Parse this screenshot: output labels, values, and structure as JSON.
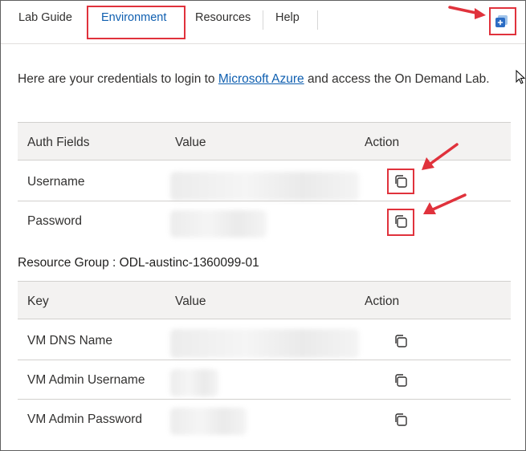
{
  "tabs": [
    {
      "label": "Lab Guide",
      "active": false
    },
    {
      "label": "Environment",
      "active": true
    },
    {
      "label": "Resources",
      "active": false
    },
    {
      "label": "Help",
      "active": false
    }
  ],
  "intro": {
    "before": "Here are your credentials to login to ",
    "link": "Microsoft Azure",
    "after": " and access the On Demand Lab."
  },
  "credentials_table": {
    "headers": [
      "Auth Fields",
      "Value",
      "Action"
    ],
    "rows": [
      {
        "field": "Username"
      },
      {
        "field": "Password"
      }
    ]
  },
  "resource_group": {
    "label": "Resource Group : ODL-austinc-1360099-01"
  },
  "vm_table": {
    "headers": [
      "Key",
      "Value",
      "Action"
    ],
    "rows": [
      {
        "field": "VM DNS Name"
      },
      {
        "field": "VM Admin Username"
      },
      {
        "field": "VM Admin Password"
      }
    ]
  },
  "icons": {
    "popout": "popout-icon",
    "copy": "copy-icon"
  },
  "colors": {
    "accent": "#0f5fb0",
    "highlight": "#e0323c",
    "header_bg": "#f3f2f1"
  }
}
